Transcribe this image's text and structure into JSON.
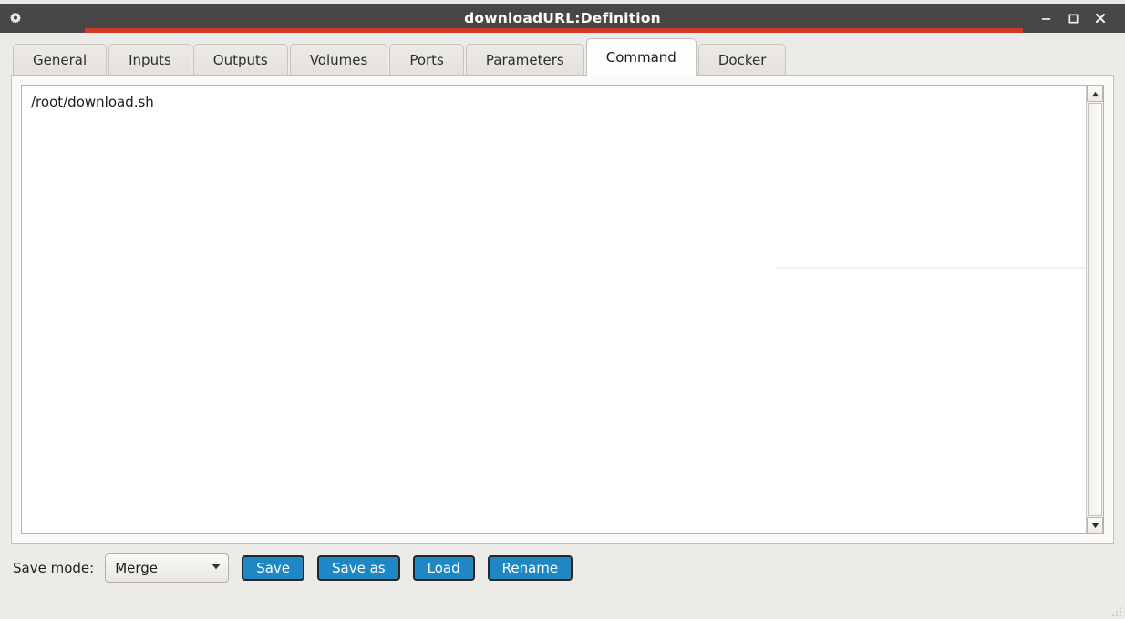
{
  "window": {
    "title": "downloadURL:Definition",
    "app_icon": "gear-icon",
    "controls": {
      "minimize": "–",
      "maximize": "□",
      "close": "✕"
    },
    "accent_color": "#cf3b27",
    "titlebar_color": "#474747"
  },
  "tabs": [
    {
      "label": "General",
      "active": false
    },
    {
      "label": "Inputs",
      "active": false
    },
    {
      "label": "Outputs",
      "active": false
    },
    {
      "label": "Volumes",
      "active": false
    },
    {
      "label": "Ports",
      "active": false
    },
    {
      "label": "Parameters",
      "active": false
    },
    {
      "label": "Command",
      "active": true
    },
    {
      "label": "Docker",
      "active": false
    }
  ],
  "editor": {
    "value": "/root/download.sh",
    "placeholder": "",
    "scrollbar": {
      "up_arrow": "▲",
      "down_arrow": "▼"
    }
  },
  "toolbar": {
    "save_mode_label": "Save mode:",
    "save_mode_value": "Merge",
    "save_mode_options": [
      "Merge"
    ],
    "dropdown_arrow": "▼",
    "buttons": [
      {
        "label": "Save"
      },
      {
        "label": "Save as"
      },
      {
        "label": "Load"
      },
      {
        "label": "Rename"
      }
    ],
    "button_color": "#1e87c4"
  }
}
